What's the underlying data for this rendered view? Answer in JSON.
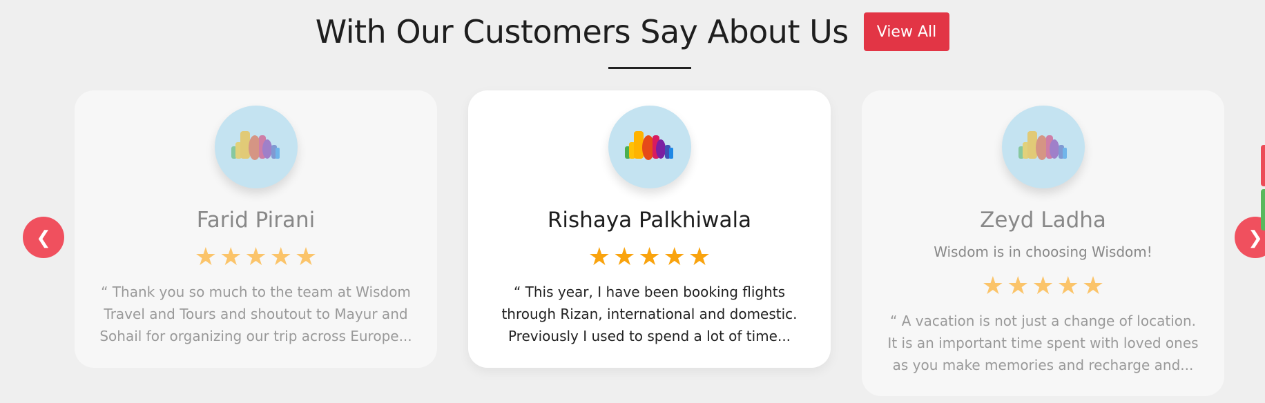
{
  "section": {
    "title": "With Our Customers Say About Us",
    "view_all_label": "View All"
  },
  "carousel": {
    "prev_icon": "❮",
    "next_icon": "❯",
    "star_glyph": "★",
    "testimonials": [
      {
        "name": "Farid Pirani",
        "rating": 5,
        "quote": "“ Thank you so much to the team at Wisdom Travel and Tours and shoutout to Mayur and Sohail for organizing our trip across Europe...",
        "lines": [
          "“ Thank you so much to the team at Wisdom",
          "Travel and Tours and shoutout to Mayur and",
          "Sohail for organizing our trip across Europe..."
        ]
      },
      {
        "name": "Rishaya Palkhiwala",
        "rating": 5,
        "quote": "“ This year, I have been booking flights through Rizan, international and domestic. Previously I used to spend a lot of time...",
        "lines": [
          "“ This year, I have been booking flights",
          "through Rizan, international and domestic.",
          "Previously I used to spend a lot of time..."
        ]
      },
      {
        "name": "Zeyd Ladha",
        "tagline": "Wisdom is in choosing Wisdom!",
        "rating": 5,
        "quote": "“ A vacation is not just a change of location. It is an important time spent with loved ones as you make memories and recharge and...",
        "lines": [
          "“ A vacation is not just a change of location.",
          "It is an important time spent with loved ones",
          "as you make memories and recharge and..."
        ]
      }
    ]
  },
  "colors": {
    "accent": "#e23545",
    "nav_button": "#f0505e",
    "star_active": "#f9a30e",
    "star_faded": "#fbc46a",
    "avatar_bg": "#c4e3f1"
  },
  "icons": {
    "avatar": "colorful-skyline-logo-icon",
    "prev": "chevron-left-icon",
    "next": "chevron-right-icon",
    "star": "star-icon"
  }
}
